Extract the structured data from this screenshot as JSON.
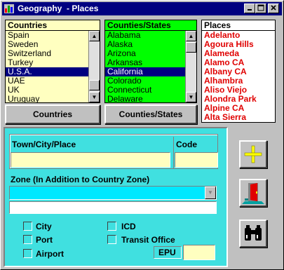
{
  "window": {
    "title": "Geography  - Places"
  },
  "lists": {
    "countries": {
      "header": "Countries",
      "items": [
        "Spain",
        "Sweden",
        "Switzerland",
        "Turkey",
        "U.S.A.",
        "UAE",
        "UK",
        "Uruguay"
      ],
      "selected": "U.S.A."
    },
    "states": {
      "header": "Counties/States",
      "items": [
        "Alabama",
        "Alaska",
        "Arizona",
        "Arkansas",
        "California",
        "Colorado",
        "Connecticut",
        "Delaware"
      ],
      "selected": "California"
    },
    "places": {
      "header": "Places",
      "items": [
        "Adelanto",
        "Agoura Hills",
        "Alameda",
        "Alamo CA",
        "Albany CA",
        "Alhambra",
        "Aliso Viejo",
        "Alondra Park",
        "Alpine CA",
        "Alta Sierra"
      ]
    }
  },
  "buttons": {
    "countries": "Countries",
    "states": "Counties/States"
  },
  "form": {
    "town_label": "Town/City/Place",
    "code_label": "Code",
    "zone_label": "Zone (In Addition to Country Zone)",
    "checks": {
      "city": "City",
      "port": "Port",
      "airport": "Airport",
      "icd": "ICD",
      "transit": "Transit Office"
    },
    "epu_label": "EPU"
  },
  "colors": {
    "titlebar": "#000080",
    "panel": "#40e0e0",
    "countries_bg": "#ffffc0",
    "states_bg": "#00ff00",
    "places_text": "#e00000"
  }
}
